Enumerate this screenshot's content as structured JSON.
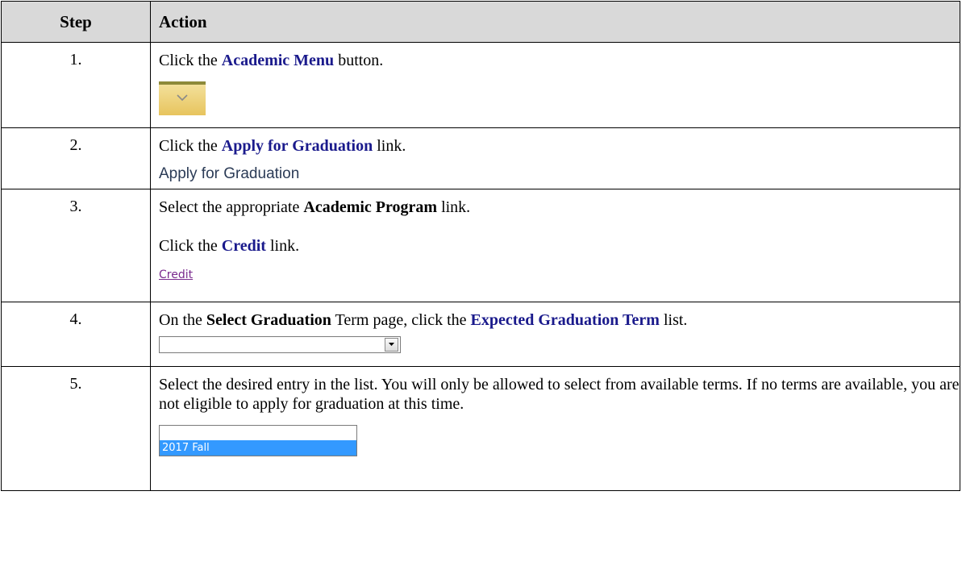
{
  "headers": {
    "step": "Step",
    "action": "Action"
  },
  "steps": [
    {
      "number": "1.",
      "text_before": "Click the ",
      "highlight": "Academic Menu",
      "text_after": " button."
    },
    {
      "number": "2.",
      "text_before": "Click the ",
      "highlight": "Apply for Graduation",
      "text_after": " link.",
      "screenshot_link": "Apply for Graduation"
    },
    {
      "number": "3.",
      "line1_before": "Select the appropriate ",
      "line1_bold": "Academic Program",
      "line1_after": " link.",
      "line2_before": "Click the ",
      "line2_highlight": "Credit",
      "line2_after": " link.",
      "screenshot_link": "Credit"
    },
    {
      "number": "4.",
      "text_before": "On the ",
      "bold": "Select Graduation",
      "text_mid": " Term page, click the ",
      "highlight": "Expected Graduation Term",
      "text_after": " list.",
      "dropdown_value": ""
    },
    {
      "number": "5.",
      "text": "Select the desired entry in the list. You will only be allowed to select from available terms. If no terms are available, you are not eligible to apply for graduation at this time.",
      "list_options": [
        "",
        "2017 Fall"
      ],
      "selected_option": "2017 Fall"
    }
  ],
  "colors": {
    "header_bg": "#d9d9d9",
    "highlight_text": "#1a1a8c",
    "menu_button": "#e7c45e",
    "selected_option_bg": "#3399ff",
    "credit_link": "#7a2a8e"
  }
}
